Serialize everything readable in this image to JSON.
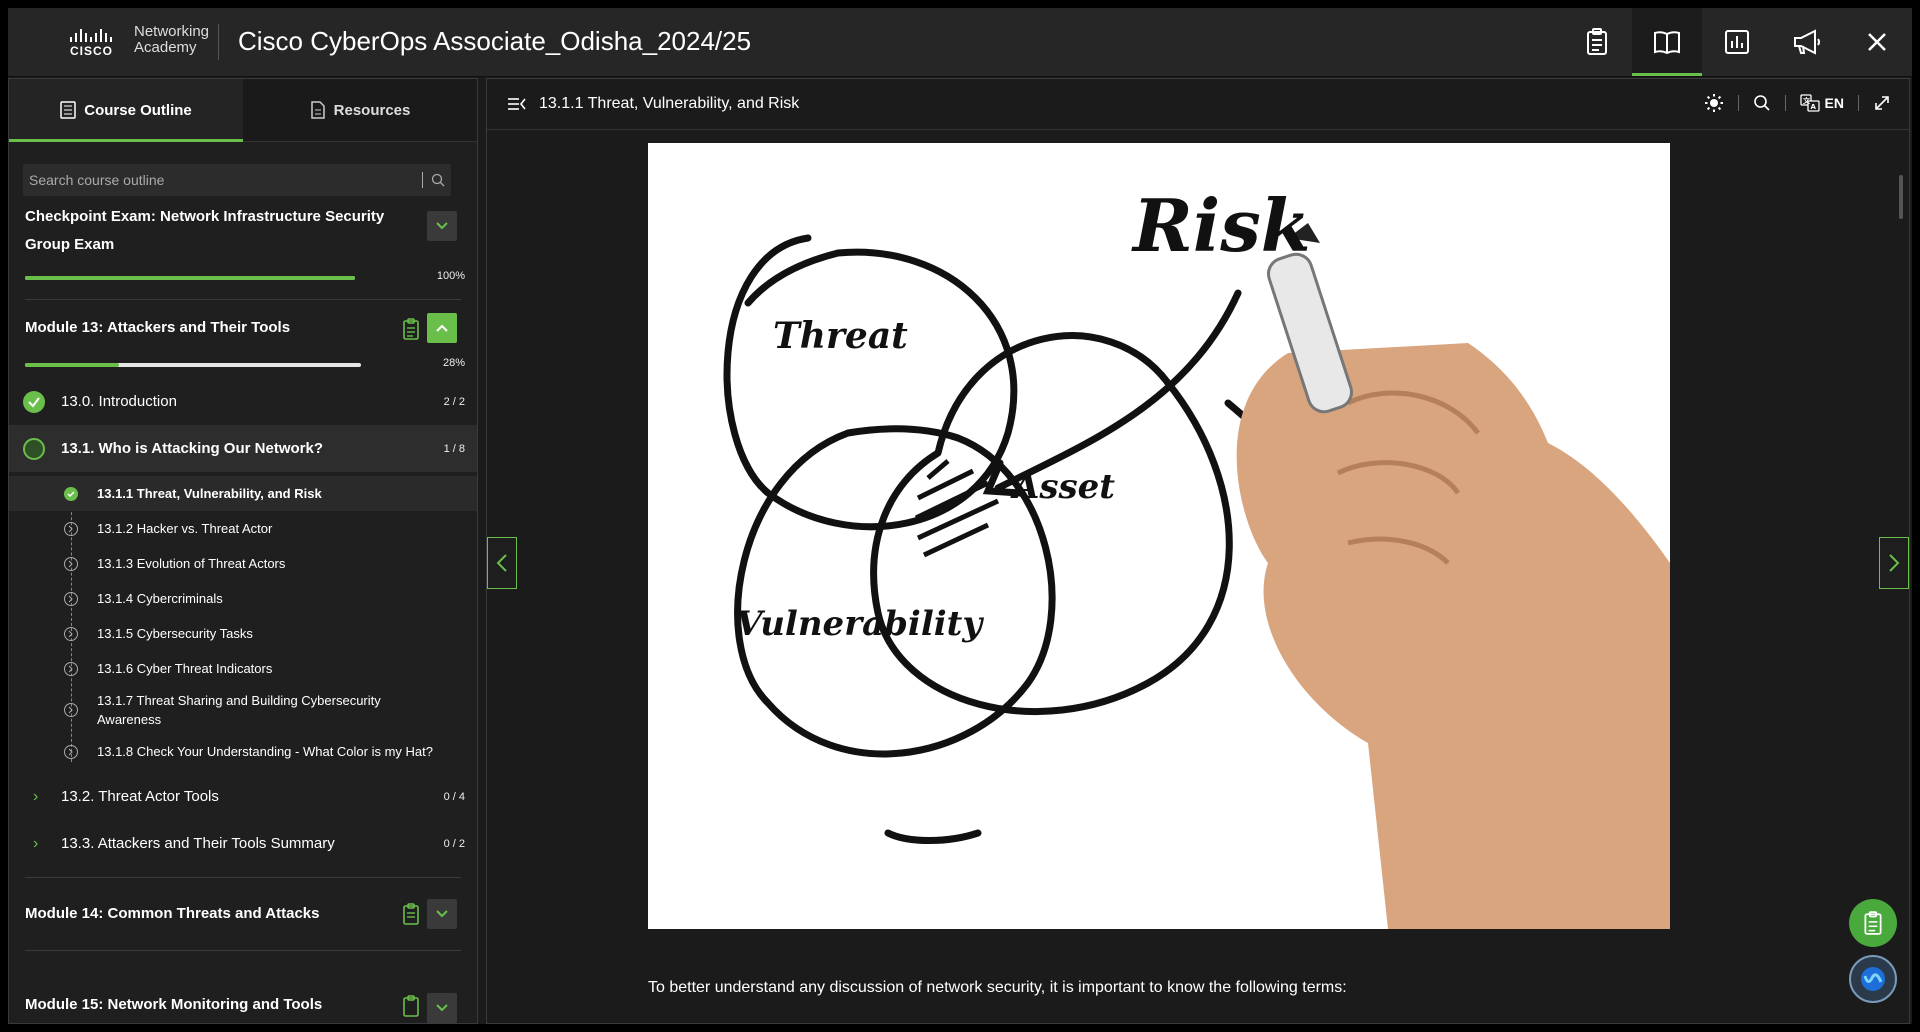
{
  "app": {
    "logo_brand": "CISCO",
    "logo_line1": "Networking",
    "logo_line2": "Academy",
    "title": "Cisco CyberOps Associate_Odisha_2024/25"
  },
  "top_icons": [
    "clipboard-icon",
    "book-icon",
    "chart-icon",
    "megaphone-icon",
    "close-icon"
  ],
  "left_tabs": {
    "outline": "Course Outline",
    "resources": "Resources"
  },
  "search": {
    "placeholder": "Search course outline"
  },
  "checkpoint": {
    "title": "Checkpoint Exam: Network Infrastructure Security Group Exam",
    "progress": 100,
    "progress_label": "100%"
  },
  "module13": {
    "title": "Module 13: Attackers and Their Tools",
    "progress": 28,
    "progress_label": "28%",
    "sections": [
      {
        "label": "13.0. Introduction",
        "count": "2 / 2"
      },
      {
        "label": "13.1. Who is Attacking Our Network?",
        "count": "1 / 8"
      }
    ],
    "subitems": [
      "13.1.1 Threat, Vulnerability, and Risk",
      "13.1.2 Hacker vs. Threat Actor",
      "13.1.3 Evolution of Threat Actors",
      "13.1.4 Cybercriminals",
      "13.1.5 Cybersecurity Tasks",
      "13.1.6 Cyber Threat Indicators",
      "13.1.7 Threat Sharing and Building Cybersecurity Awareness",
      "13.1.8 Check Your Understanding - What Color is my Hat?"
    ],
    "more_sections": [
      {
        "label": "13.2. Threat Actor Tools",
        "count": "0 / 4"
      },
      {
        "label": "13.3. Attackers and Their Tools Summary",
        "count": "0 / 2"
      }
    ]
  },
  "module14": {
    "title": "Module 14: Common Threats and Attacks"
  },
  "module15": {
    "title": "Module 15: Network Monitoring and Tools"
  },
  "content": {
    "header_title": "13.1.1 Threat, Vulnerability, and Risk",
    "lang": "EN",
    "image_words": {
      "risk": "Risk",
      "threat": "Threat",
      "asset": "Asset",
      "vulnerability": "Vulnerability"
    },
    "paragraph": "To better understand any discussion of network security, it is important to know the following terms:"
  },
  "colors": {
    "accent": "#6abf4b",
    "bg": "#1b1b1b"
  }
}
